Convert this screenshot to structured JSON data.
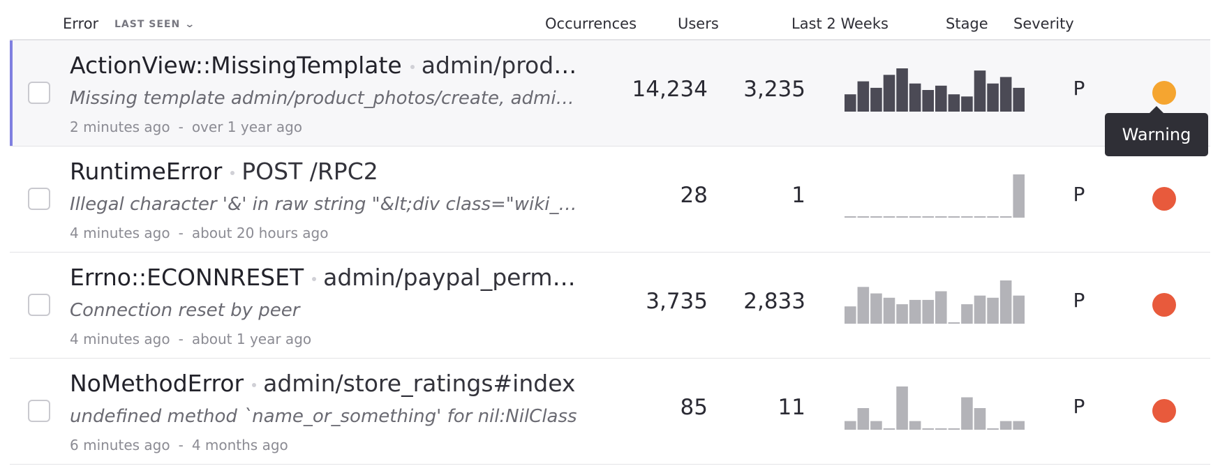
{
  "header": {
    "error": "Error",
    "sort": "LAST SEEN",
    "sort_chevron": "⌄",
    "occurrences": "Occurrences",
    "users": "Users",
    "last_two_weeks": "Last 2 Weeks",
    "stage": "Stage",
    "severity": "Severity"
  },
  "tooltip": "Warning",
  "colors": {
    "warning": "#f5a530",
    "error": "#e85a3c",
    "bar_dark": "#4b4a55",
    "bar_light": "#b3b3b8"
  },
  "rows": [
    {
      "klass": "ActionView::MissingTemplate",
      "context": "admin/product_photos/create",
      "message": "Missing template admin/product_photos/create, admin/application/create with {:locale=>[:en]}",
      "last_seen": "2 minutes ago",
      "first_seen": "over 1 year ago",
      "occurrences": "14,234",
      "users": "3,235",
      "stage": "P",
      "severity": "warning",
      "trend": [
        4,
        7,
        5.5,
        8.5,
        10,
        6.5,
        5,
        6,
        4,
        3.5,
        9.5,
        6.5,
        8,
        5.5
      ],
      "trend_style": "dark"
    },
    {
      "klass": "RuntimeError",
      "context": "POST /RPC2",
      "message": "Illegal character '&' in raw string \"&lt;div class=\"wiki_entry\"",
      "last_seen": "4 minutes ago",
      "first_seen": "about 20 hours ago",
      "occurrences": "28",
      "users": "1",
      "stage": "P",
      "severity": "error",
      "trend": [
        0,
        0,
        0,
        0,
        0,
        0,
        0,
        0,
        0,
        0,
        0,
        0,
        0,
        10
      ],
      "trend_style": "light"
    },
    {
      "klass": "Errno::ECONNRESET",
      "context": "admin/paypal_permissions/callback",
      "message": "Connection reset by peer",
      "last_seen": "4 minutes ago",
      "first_seen": "about 1 year ago",
      "occurrences": "3,735",
      "users": "2,833",
      "stage": "P",
      "severity": "error",
      "trend": [
        4,
        8.5,
        7,
        6,
        4.5,
        5.5,
        5.5,
        7.5,
        0,
        4.5,
        6.5,
        6,
        10,
        6.5
      ],
      "trend_style": "light"
    },
    {
      "klass": "NoMethodError",
      "context": "admin/store_ratings#index",
      "message": "undefined method `name_or_something' for nil:NilClass",
      "last_seen": "6 minutes ago",
      "first_seen": "4 months ago",
      "occurrences": "85",
      "users": "11",
      "stage": "P",
      "severity": "error",
      "trend": [
        2,
        5,
        2,
        0,
        10,
        2,
        0,
        0,
        0,
        7.5,
        5,
        0,
        2,
        2
      ],
      "trend_style": "light"
    }
  ]
}
